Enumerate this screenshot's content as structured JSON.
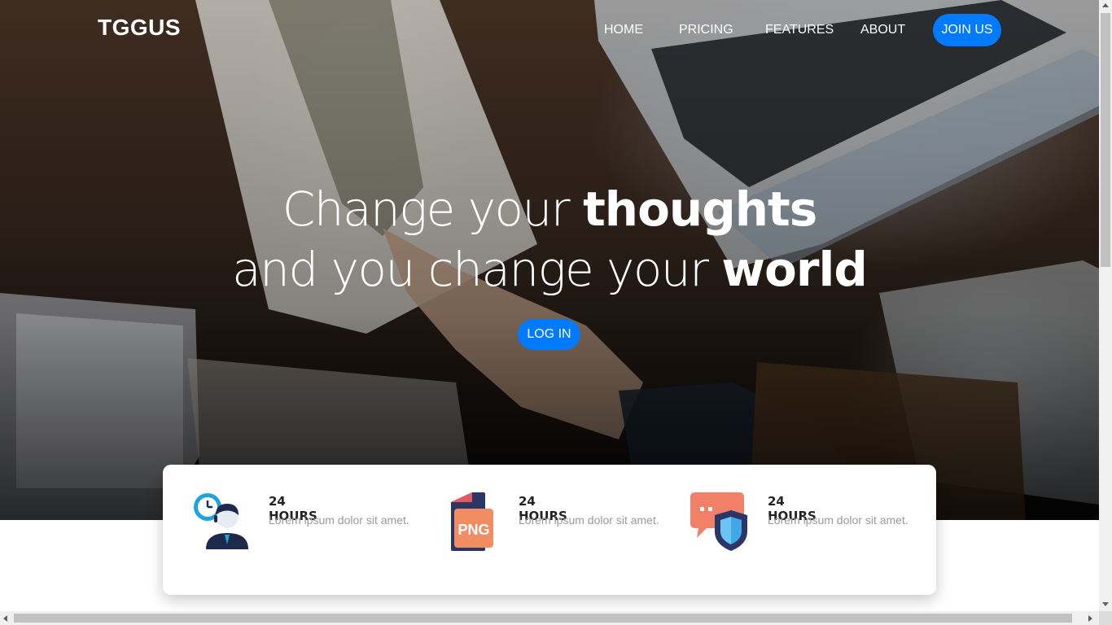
{
  "brand": {
    "logo_text": "TGGUS"
  },
  "nav": {
    "items": [
      {
        "label": "HOME"
      },
      {
        "label": "PRICING"
      },
      {
        "label": "FEATURES"
      },
      {
        "label": "ABOUT"
      }
    ],
    "join_label": "JOIN US"
  },
  "hero": {
    "line1_light": "Change your ",
    "line1_bold": "thoughts",
    "line2_light": "and you change your ",
    "line2_bold": "world",
    "login_label": "LOG IN",
    "background": "handshake-over-desk-photo"
  },
  "features": [
    {
      "icon": "support-agent-clock-icon",
      "title": "24 HOURS",
      "text": "Lorem ipsum dolor sit amet."
    },
    {
      "icon": "png-file-icon",
      "title": "24 HOURS",
      "text": "Lorem ipsum dolor sit amet.",
      "icon_text": "PNG"
    },
    {
      "icon": "chat-shield-icon",
      "title": "24 HOURS",
      "text": "Lorem ipsum dolor sit amet."
    }
  ],
  "colors": {
    "accent": "#007bff",
    "card_bg": "#ffffff",
    "muted_text": "#9a9a9a"
  }
}
